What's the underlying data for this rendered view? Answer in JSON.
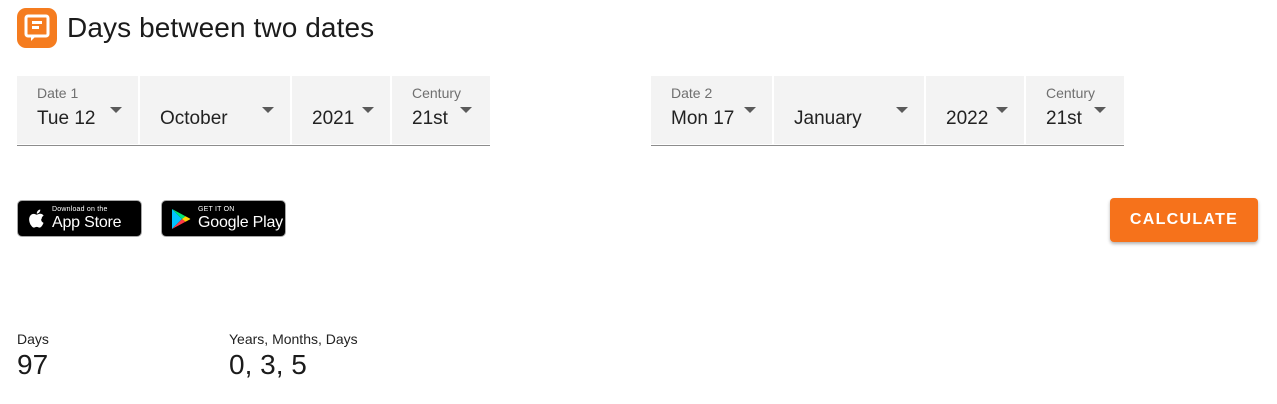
{
  "header": {
    "title": "Days between two dates",
    "logo_color": "#f57c1f"
  },
  "date1": {
    "label": "Date 1",
    "day": "Tue 12",
    "month": "October",
    "year": "2021",
    "century_label": "Century",
    "century": "21st"
  },
  "date2": {
    "label": "Date 2",
    "day": "Mon 17",
    "month": "January",
    "year": "2022",
    "century_label": "Century",
    "century": "21st"
  },
  "badges": {
    "apple_small": "Download on the",
    "apple_big": "App Store",
    "gplay_small": "GET IT ON",
    "gplay_big": "Google Play"
  },
  "calculate_label": "CALCULATE",
  "accent_color": "#f6721b",
  "results": {
    "days_label": "Days",
    "days_value": "97",
    "ymd_label": "Years, Months, Days",
    "ymd_value": "0, 3, 5"
  }
}
